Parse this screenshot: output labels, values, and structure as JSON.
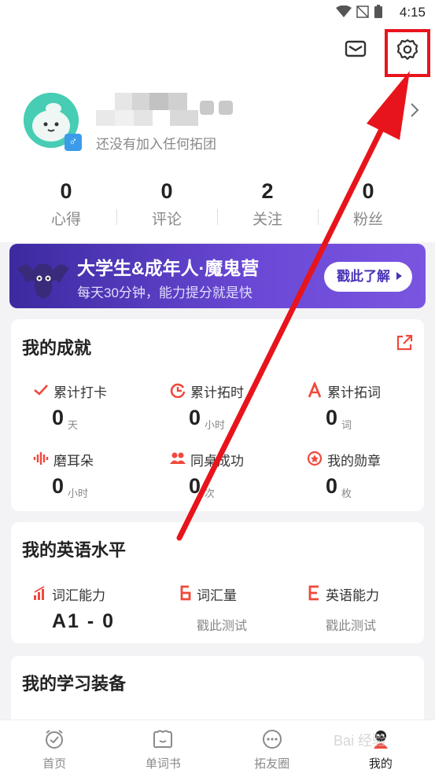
{
  "status_bar": {
    "time": "4:15",
    "icons": [
      "wifi-icon",
      "no-signal-icon",
      "battery-icon"
    ]
  },
  "header": {
    "icons": [
      "mail-icon",
      "gear-icon",
      "chevron-right-icon",
      "male-icon"
    ],
    "gender_symbol": "♂",
    "subtitle": "还没有加入任何拓团",
    "stats": [
      {
        "value": "0",
        "label": "心得"
      },
      {
        "value": "0",
        "label": "评论"
      },
      {
        "value": "2",
        "label": "关注"
      },
      {
        "value": "0",
        "label": "粉丝"
      }
    ]
  },
  "banner": {
    "title": "大学生&成年人·魔鬼营",
    "subtitle": "每天30分钟，能力提分就是快",
    "button": "戳此了解"
  },
  "achievements": {
    "title": "我的成就",
    "items": [
      {
        "icon": "check-icon",
        "name": "累计打卡",
        "value": "0",
        "unit": "天"
      },
      {
        "icon": "clock-icon",
        "name": "累计拓时",
        "value": "0",
        "unit": "小时"
      },
      {
        "icon": "letter-a-icon",
        "name": "累计拓词",
        "value": "0",
        "unit": "词"
      },
      {
        "icon": "soundwave-icon",
        "name": "磨耳朵",
        "value": "0",
        "unit": "小时"
      },
      {
        "icon": "people-icon",
        "name": "同桌成功",
        "value": "0",
        "unit": "次"
      },
      {
        "icon": "medal-icon",
        "name": "我的勋章",
        "value": "0",
        "unit": "枚"
      }
    ]
  },
  "english_level": {
    "title": "我的英语水平",
    "items": [
      {
        "icon": "bar-chart-icon",
        "name": "词汇能力",
        "value": "A1 - 0"
      },
      {
        "icon": "vocab-icon",
        "name": "词汇量",
        "hint": "戳此测试"
      },
      {
        "icon": "letter-e-icon",
        "name": "英语能力",
        "hint": "戳此测试"
      }
    ]
  },
  "study_gear": {
    "title": "我的学习装备"
  },
  "tabbar": {
    "tabs": [
      {
        "icon": "alarm-clock-icon",
        "label": "首页"
      },
      {
        "icon": "book-icon",
        "label": "单词书"
      },
      {
        "icon": "chat-bubble-icon",
        "label": "拓友圈"
      },
      {
        "icon": "profile-icon",
        "label": "我的"
      }
    ],
    "active": "我的"
  },
  "watermark": "Bai 经验",
  "colors": {
    "accent_red": "#f0483c",
    "banner_purple": "#5a3dc8",
    "annotation_red": "#e8141c"
  }
}
